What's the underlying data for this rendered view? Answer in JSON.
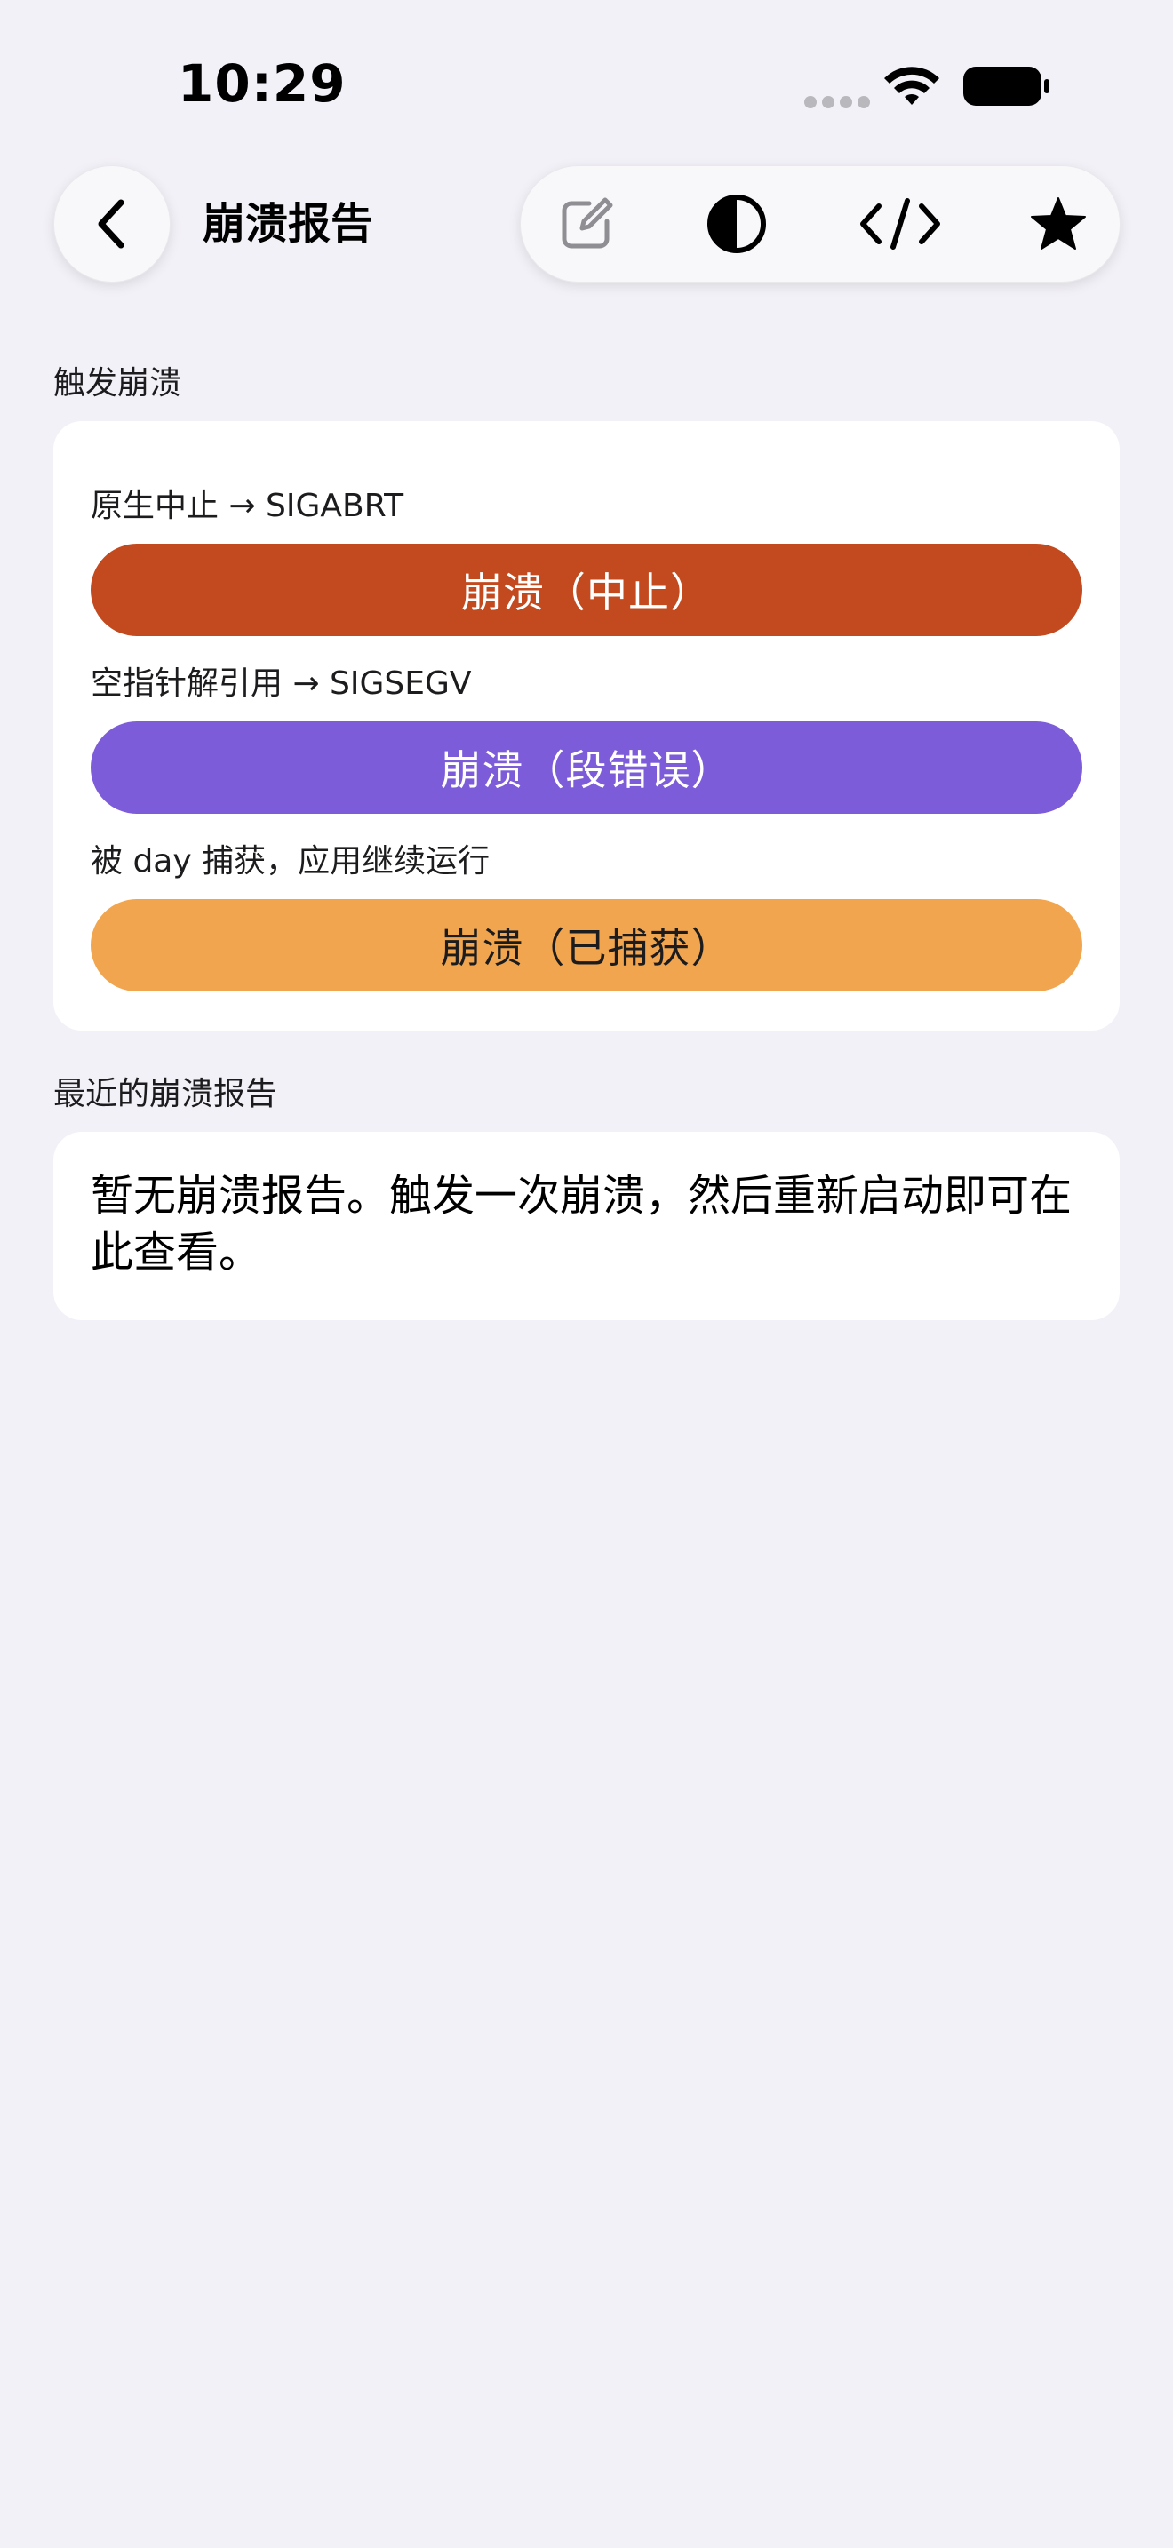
{
  "status_bar": {
    "time": "10:29",
    "icons": [
      "signal-dots-icon",
      "wifi-icon",
      "battery-icon"
    ]
  },
  "nav": {
    "back_icon": "chevron-left-icon",
    "title": "崩溃报告",
    "toolbar": [
      {
        "icon": "edit-icon"
      },
      {
        "icon": "contrast-icon"
      },
      {
        "icon": "code-icon"
      },
      {
        "icon": "star-icon"
      }
    ]
  },
  "trigger_section": {
    "header": "触发崩溃",
    "items": [
      {
        "caption": "原生中止 → SIGABRT",
        "button_label": "崩溃（中止）",
        "color": "#c3491e",
        "text_color": "#ffffff"
      },
      {
        "caption": "空指针解引用 → SIGSEGV",
        "button_label": "崩溃（段错误）",
        "color": "#7c5cd9",
        "text_color": "#ffffff"
      },
      {
        "caption": "被 day 捕获，应用继续运行",
        "button_label": "崩溃（已捕获）",
        "color": "#f0a54e",
        "text_color": "#1c1c1e"
      }
    ]
  },
  "recent_section": {
    "header": "最近的崩溃报告",
    "empty_message": "暂无崩溃报告。触发一次崩溃，然后重新启动即可在此查看。"
  }
}
